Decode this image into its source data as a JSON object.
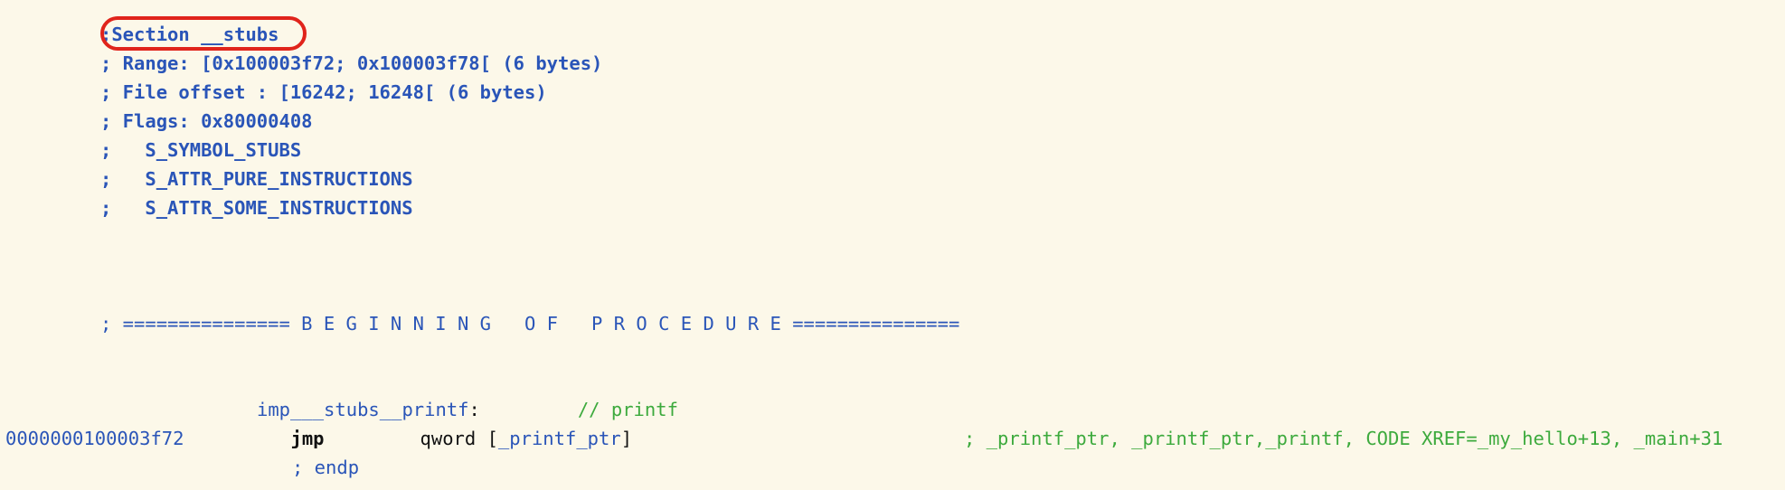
{
  "section_header": {
    "prefix": ";",
    "title": "Section __stubs",
    "range": "; Range: [0x100003f72; 0x100003f78[ (6 bytes)",
    "file_offset": "; File offset : [16242; 16248[ (6 bytes)",
    "flags": "; Flags: 0x80000408",
    "flag_items": [
      ";   S_SYMBOL_STUBS",
      ";   S_ATTR_PURE_INSTRUCTIONS",
      ";   S_ATTR_SOME_INSTRUCTIONS"
    ]
  },
  "banner": "; =============== B E G I N N I N G   O F   P R O C E D U R E ===============",
  "procedure": {
    "label": "imp___stubs__printf",
    "label_colon": ":",
    "label_comment": "// printf",
    "address": "0000000100003f72",
    "mnemonic": "jmp",
    "operand_prefix": "qword [",
    "operand_symbol": "_printf_ptr",
    "operand_suffix": "]",
    "xref_comment": "; _printf_ptr, _printf_ptr,_printf, CODE XREF=_my_hello+13, _main+31",
    "endp": "; endp"
  },
  "colors": {
    "background": "#fcf8e9",
    "blue": "#2a55b8",
    "green": "#3daa3d",
    "highlight": "#e0241b"
  }
}
